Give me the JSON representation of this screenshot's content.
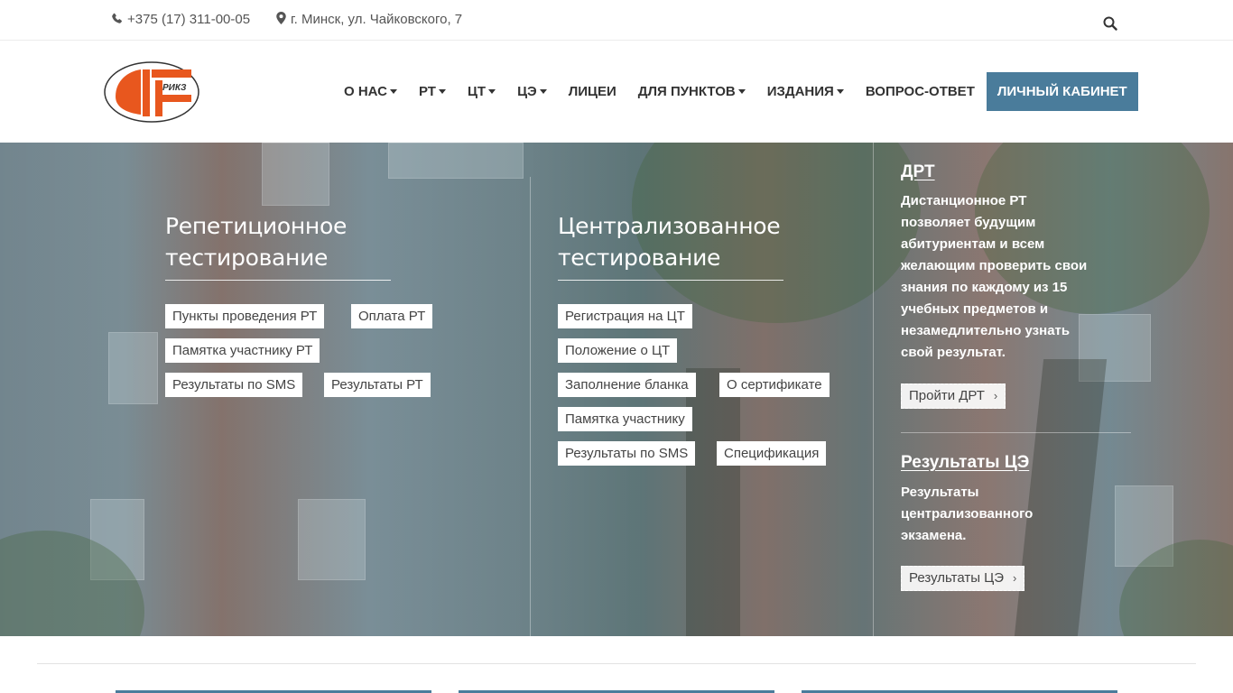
{
  "topbar": {
    "phone": "+375 (17) 311-00-05",
    "address": "г. Минск, ул. Чайковского, 7",
    "phone_icon": "phone-icon",
    "address_icon": "map-marker-icon",
    "search_icon": "search-icon"
  },
  "logo": {
    "text": "РИКЗ"
  },
  "nav": {
    "items": [
      {
        "label": "О НАС",
        "dropdown": true
      },
      {
        "label": "РТ",
        "dropdown": true
      },
      {
        "label": "ЦТ",
        "dropdown": true
      },
      {
        "label": "ЦЭ",
        "dropdown": true
      },
      {
        "label": "ЛИЦЕИ",
        "dropdown": false
      },
      {
        "label": "ДЛЯ ПУНКТОВ",
        "dropdown": true
      },
      {
        "label": "ИЗДАНИЯ",
        "dropdown": true
      },
      {
        "label": "ВОПРОС-ОТВЕТ",
        "dropdown": false
      }
    ],
    "cabinet": "ЛИЧНЫЙ КАБИНЕТ"
  },
  "rt": {
    "title_line1": "Репетиционное",
    "title_line2": "тестирование",
    "links": [
      "Пункты проведения РТ",
      "Оплата РТ",
      "Памятка участнику РТ",
      "Результаты по SMS",
      "Результаты РТ"
    ]
  },
  "ct": {
    "title_line1": "Централизованное",
    "title_line2": "тестирование",
    "links": [
      "Регистрация на ЦТ",
      "Положение о ЦТ",
      "Заполнение бланка",
      "О сертификате",
      "Памятка участнику",
      "Результаты по SMS",
      "Спецификация"
    ]
  },
  "drt": {
    "title": "ДРТ",
    "text": "Дистанционное РТ позволяет будущим абитуриентам и всем желающим проверить свои знания по каждому из 15 учебных предметов и незамедлительно узнать свой результат.",
    "button": "Пройти ДРТ"
  },
  "ce": {
    "title": "Результаты ЦЭ",
    "text": "Результаты централизованного экзамена.",
    "button": "Результаты ЦЭ"
  },
  "colors": {
    "accent": "#4a7c9b",
    "logo_orange": "#e8571e"
  }
}
